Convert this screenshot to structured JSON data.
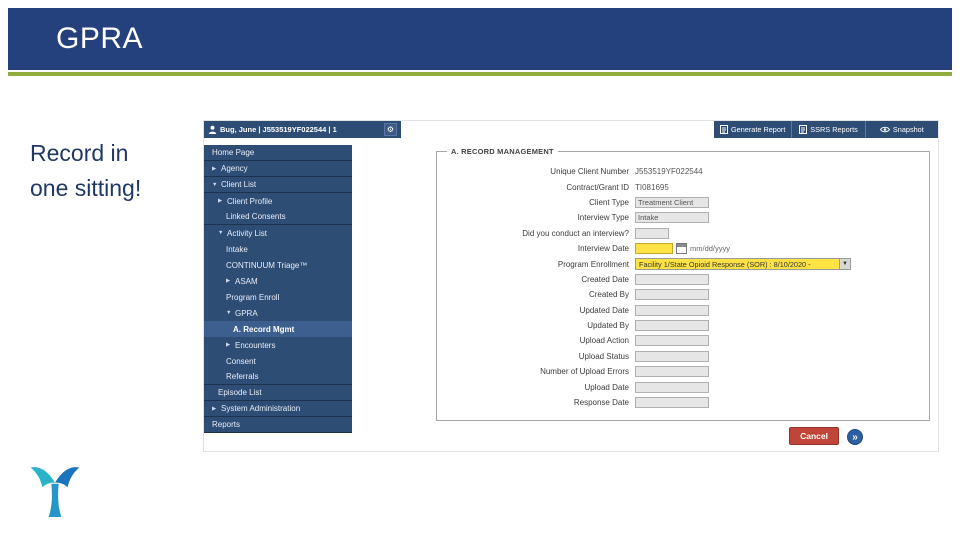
{
  "slide": {
    "title": "GPRA",
    "caption_line1": "Record in",
    "caption_line2": "one sitting!"
  },
  "colors": {
    "header_navy": "#25417d",
    "accent_green": "#8fae3e",
    "app_navy": "#2e4d75",
    "required_yellow": "#ffe345",
    "cancel_red": "#bf4538",
    "forward_blue": "#2e5fa3"
  },
  "app": {
    "topbar": {
      "user_text": "Bug, June | J553519YF022544 | 1",
      "gear_glyph": "⚙",
      "links": [
        {
          "label": "Generate Report",
          "icon": "report-icon"
        },
        {
          "label": "SSRS Reports",
          "icon": "report-icon"
        },
        {
          "label": "Snapshot",
          "icon": "eye-icon"
        }
      ]
    },
    "sidebar": {
      "items": [
        {
          "label": "Home Page",
          "arrow": "",
          "indent": 0,
          "sep": true
        },
        {
          "label": "Agency",
          "arrow": "right",
          "indent": 0,
          "sep": true
        },
        {
          "label": "Client List",
          "arrow": "down",
          "indent": 0,
          "sep": true
        },
        {
          "label": "Client Profile",
          "arrow": "right",
          "indent": 1,
          "sep": false
        },
        {
          "label": "Linked Consents",
          "arrow": "",
          "indent": 2,
          "sep": true
        },
        {
          "label": "Activity List",
          "arrow": "down",
          "indent": 1,
          "sep": false
        },
        {
          "label": "Intake",
          "arrow": "",
          "indent": 2,
          "sep": false
        },
        {
          "label": "CONTINUUM Triage™",
          "arrow": "",
          "indent": 2,
          "sep": false
        },
        {
          "label": "ASAM",
          "arrow": "right",
          "indent": 2,
          "sep": false
        },
        {
          "label": "Program Enroll",
          "arrow": "",
          "indent": 2,
          "sep": false
        },
        {
          "label": "GPRA",
          "arrow": "down",
          "indent": 2,
          "sep": false
        },
        {
          "label": "A. Record Mgmt",
          "arrow": "",
          "indent": 3,
          "sep": false,
          "active": true
        },
        {
          "label": "Encounters",
          "arrow": "right",
          "indent": 2,
          "sep": false
        },
        {
          "label": "Consent",
          "arrow": "",
          "indent": 2,
          "sep": false
        },
        {
          "label": "Referrals",
          "arrow": "",
          "indent": 2,
          "sep": true
        },
        {
          "label": "Episode List",
          "arrow": "",
          "indent": 1,
          "sep": true
        },
        {
          "label": "System Administration",
          "arrow": "right",
          "indent": 0,
          "sep": true
        },
        {
          "label": "Reports",
          "arrow": "",
          "indent": 0,
          "sep": true
        }
      ]
    },
    "form": {
      "legend": "A. RECORD MANAGEMENT",
      "date_hint": "mm/dd/yyyy",
      "fields": [
        {
          "label": "Unique Client Number",
          "value": "J553519YF022544",
          "kind": "static"
        },
        {
          "label": "Contract/Grant ID",
          "value": "TI081695",
          "kind": "static"
        },
        {
          "label": "Client Type",
          "value": "Treatment Client",
          "kind": "input"
        },
        {
          "label": "Interview Type",
          "value": "Intake",
          "kind": "input"
        },
        {
          "label": "Did you conduct an interview?",
          "value": "",
          "kind": "input-small"
        },
        {
          "label": "Interview Date",
          "value": "",
          "kind": "date"
        },
        {
          "label": "Program Enrollment",
          "value": "Facility 1/State Opioid Response (SOR) : 8/10/2020 -",
          "kind": "select"
        },
        {
          "label": "Created Date",
          "value": "",
          "kind": "input"
        },
        {
          "label": "Created By",
          "value": "",
          "kind": "input"
        },
        {
          "label": "Updated Date",
          "value": "",
          "kind": "input"
        },
        {
          "label": "Updated By",
          "value": "",
          "kind": "input"
        },
        {
          "label": "Upload Action",
          "value": "",
          "kind": "input"
        },
        {
          "label": "Upload Status",
          "value": "",
          "kind": "input"
        },
        {
          "label": "Number of Upload Errors",
          "value": "",
          "kind": "input"
        },
        {
          "label": "Upload Date",
          "value": "",
          "kind": "input"
        },
        {
          "label": "Response Date",
          "value": "",
          "kind": "input"
        }
      ]
    },
    "footer": {
      "cancel_label": "Cancel",
      "forward_glyph": "»"
    }
  }
}
